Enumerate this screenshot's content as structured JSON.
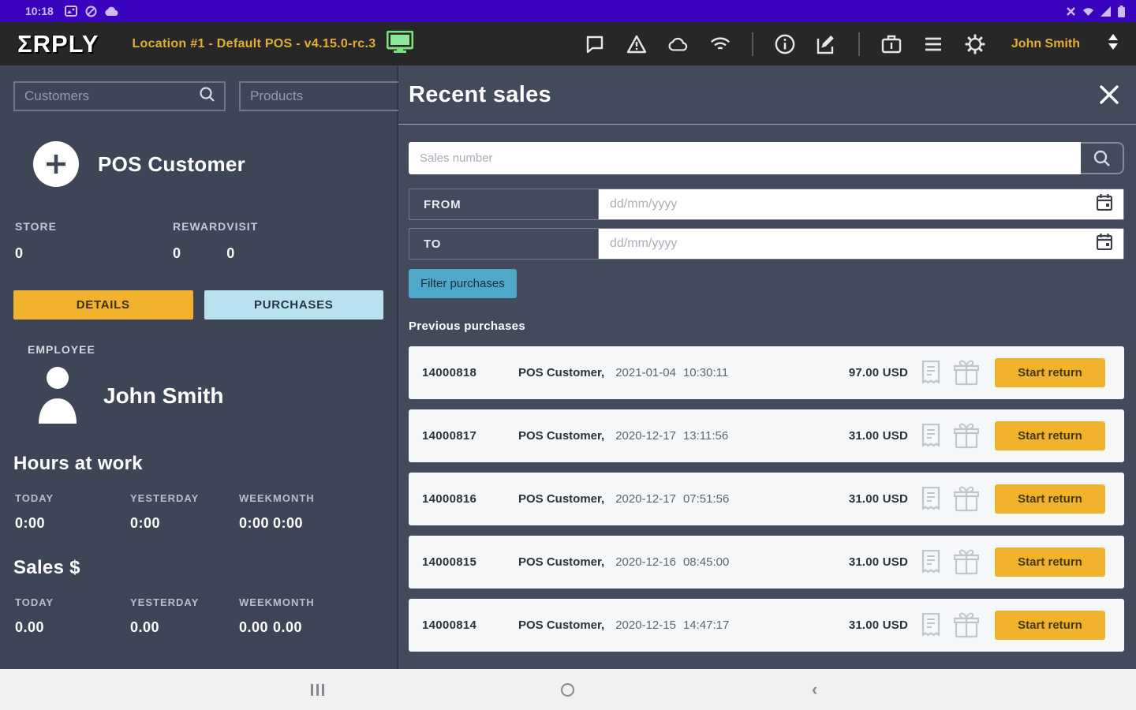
{
  "colors": {
    "status_bar": "#3A04BE",
    "header": "#272727",
    "accent_gold": "#E3AE34",
    "sidebar_bg": "#3E4556",
    "panel_bg": "#424A5C",
    "yellow_button": "#F1B32E",
    "lightblue_button": "#B9E2F0",
    "teal_button": "#4FA7C9",
    "row_bg": "#F6F7F8",
    "monitor_green": "#7CE37C"
  },
  "status_bar": {
    "time": "10:18",
    "left_icons": [
      "image-icon",
      "blocked-icon",
      "cloud-icon"
    ],
    "right_icons": [
      "mute-icon",
      "wifi-icon",
      "signal-icon",
      "battery-icon"
    ]
  },
  "header": {
    "logo": "ΣRPLY",
    "location": "Location #1 - Default POS - v4.15.0-rc.3",
    "icons": [
      "monitor",
      "chat",
      "warning",
      "cloud",
      "wifi",
      "info",
      "edit",
      "briefcase",
      "menu",
      "settings"
    ],
    "user": "John Smith"
  },
  "sidebar": {
    "customers_placeholder": "Customers",
    "products_placeholder": "Products",
    "customer_name": "POS Customer",
    "stats": [
      {
        "label": "STORE",
        "value": "0"
      },
      {
        "label": "REWARD",
        "value": "0"
      },
      {
        "label": "VISIT",
        "value": "0"
      }
    ],
    "details_button": "DETAILS",
    "purchases_button": "PURCHASES",
    "employee_label": "EMPLOYEE",
    "employee_name": "John Smith",
    "hours_title": "Hours at work",
    "hours": [
      {
        "label": "TODAY",
        "value": "0:00"
      },
      {
        "label": "YESTERDAY",
        "value": "0:00"
      },
      {
        "label": "WEEK",
        "value": "0:00"
      },
      {
        "label": "MONTH",
        "value": "0:00"
      }
    ],
    "sales_title": "Sales $",
    "sales": [
      {
        "label": "TODAY",
        "value": "0.00"
      },
      {
        "label": "YESTERDAY",
        "value": "0.00"
      },
      {
        "label": "WEEK",
        "value": "0.00"
      },
      {
        "label": "MONTH",
        "value": "0.00"
      }
    ]
  },
  "panel": {
    "title": "Recent sales",
    "search_placeholder": "Sales number",
    "from_label": "FROM",
    "to_label": "TO",
    "date_placeholder": "dd/mm/yyyy",
    "filter_button": "Filter purchases",
    "list_title": "Previous purchases",
    "purchases": [
      {
        "number": "14000818",
        "customer": "POS Customer,",
        "date": "2021-01-04",
        "time": "10:30:11",
        "amount": "97.00 USD",
        "action": "Start return"
      },
      {
        "number": "14000817",
        "customer": "POS Customer,",
        "date": "2020-12-17",
        "time": "13:11:56",
        "amount": "31.00 USD",
        "action": "Start return"
      },
      {
        "number": "14000816",
        "customer": "POS Customer,",
        "date": "2020-12-17",
        "time": "07:51:56",
        "amount": "31.00 USD",
        "action": "Start return"
      },
      {
        "number": "14000815",
        "customer": "POS Customer,",
        "date": "2020-12-16",
        "time": "08:45:00",
        "amount": "31.00 USD",
        "action": "Start return"
      },
      {
        "number": "14000814",
        "customer": "POS Customer,",
        "date": "2020-12-15",
        "time": "14:47:17",
        "amount": "31.00 USD",
        "action": "Start return"
      }
    ]
  },
  "nav_bar": {
    "icons": [
      "recent-apps",
      "home",
      "back"
    ]
  }
}
